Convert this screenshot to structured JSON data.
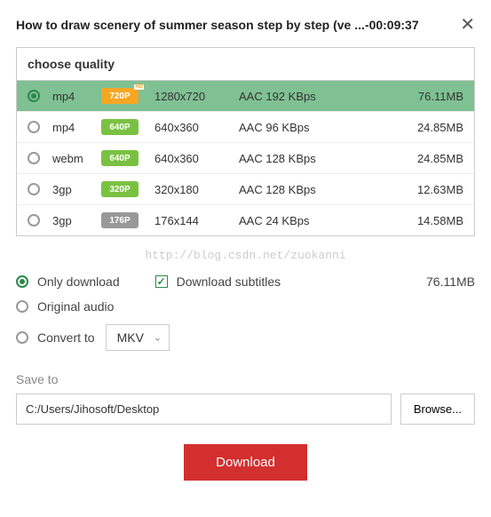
{
  "header": {
    "title": "How to draw scenery of summer season step by step (ve ...-00:09:37"
  },
  "quality": {
    "label": "choose quality",
    "rows": [
      {
        "format": "mp4",
        "badge": "720P",
        "badgeColor": "orange",
        "hd": "HD",
        "resolution": "1280x720",
        "audio": "AAC 192 KBps",
        "size": "76.11MB",
        "selected": true
      },
      {
        "format": "mp4",
        "badge": "640P",
        "badgeColor": "green",
        "resolution": "640x360",
        "audio": "AAC 96 KBps",
        "size": "24.85MB",
        "selected": false
      },
      {
        "format": "webm",
        "badge": "640P",
        "badgeColor": "green",
        "resolution": "640x360",
        "audio": "AAC 128 KBps",
        "size": "24.85MB",
        "selected": false
      },
      {
        "format": "3gp",
        "badge": "320P",
        "badgeColor": "green",
        "resolution": "320x180",
        "audio": "AAC 128 KBps",
        "size": "12.63MB",
        "selected": false
      },
      {
        "format": "3gp",
        "badge": "176P",
        "badgeColor": "gray",
        "resolution": "176x144",
        "audio": "AAC 24 KBps",
        "size": "14.58MB",
        "selected": false
      }
    ]
  },
  "watermark": "http://blog.csdn.net/zuokanni",
  "options": {
    "only_download": "Only download",
    "download_subtitles": "Download subtitles",
    "original_audio": "Original audio",
    "convert_to": "Convert to",
    "convert_value": "MKV",
    "size": "76.11MB"
  },
  "save": {
    "label": "Save to",
    "path": "C:/Users/Jihosoft/Desktop",
    "browse": "Browse..."
  },
  "download_label": "Download"
}
